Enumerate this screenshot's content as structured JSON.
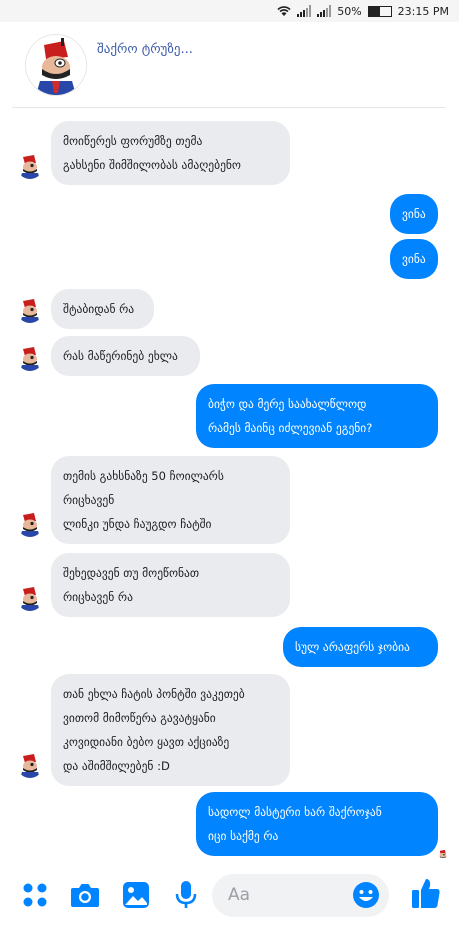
{
  "status_bar": {
    "battery_percent": "50%",
    "battery_level": 0.5,
    "time": "23:15 PM",
    "icons": [
      "wifi-icon",
      "signal-icon",
      "signal-icon",
      "battery-icon"
    ]
  },
  "header": {
    "contact_name": "შაქრო ტრუზე..."
  },
  "messages": [
    {
      "side": "in",
      "lines": [
        "მოიწერეს ფორუმზე თემა",
        "გახსენი შიმშილობას ამაღებენო"
      ]
    },
    {
      "side": "out",
      "lines": [
        "ვინა"
      ]
    },
    {
      "side": "out",
      "lines": [
        "ვინა"
      ]
    },
    {
      "side": "in",
      "lines": [
        "შტაბიდან რა"
      ]
    },
    {
      "side": "in",
      "lines": [
        "რას მაწერინებ ეხლა"
      ]
    },
    {
      "side": "out",
      "lines": [
        "ბიჭო და მერე საახალწლოდ",
        "რამეს მაინც იძლევიან ეგენი?"
      ]
    },
    {
      "side": "in",
      "lines": [
        "თემის გახსნაზე 50 ჩოილარს",
        "რიცხავენ",
        "ლინკი უნდა ჩაუგდო ჩატში"
      ]
    },
    {
      "side": "in",
      "lines": [
        "შეხედავენ თუ მოეწონათ",
        "რიცხავენ რა"
      ]
    },
    {
      "side": "out",
      "lines": [
        "სულ არაფერს ჯობია"
      ]
    },
    {
      "side": "in",
      "lines": [
        "თან ეხლა ჩატის პონტში ვაკეთებ",
        "ვითომ მიმოწერა გავატყანი",
        "კოვიდიანი ბებო ყავთ აქციაზე",
        "და აშიმშილებენ :D"
      ]
    },
    {
      "side": "out",
      "lines": [
        "სადოლ მასტერი ხარ შაქროჯან",
        "იცი საქმე რა"
      ]
    }
  ],
  "composer": {
    "placeholder": "Aa",
    "icons": [
      "menu-dots-icon",
      "camera-icon",
      "gallery-icon",
      "microphone-icon",
      "emoji-icon",
      "like-thumb-icon"
    ]
  },
  "colors": {
    "accent": "#0084ff",
    "incoming_bubble": "#e9ebee",
    "name": "#3b5aa8"
  }
}
